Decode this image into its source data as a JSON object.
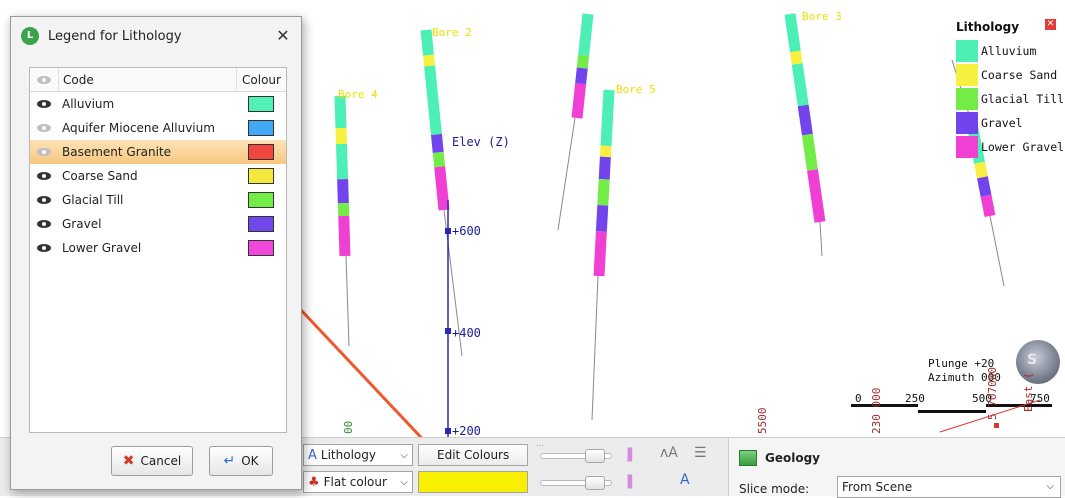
{
  "scene": {
    "bores": [
      {
        "label": "Bore 2"
      },
      {
        "label": "Bore 3"
      },
      {
        "label": "Bore 4"
      },
      {
        "label": "Bore 5"
      }
    ],
    "axis": {
      "title": "Elev (Z)",
      "ticks": [
        "+600",
        "+400",
        "+200"
      ]
    },
    "legend": {
      "title": "Lithology",
      "items": [
        {
          "label": "Alluvium",
          "color": "#4cf0b4"
        },
        {
          "label": "Coarse Sand",
          "color": "#f8f040"
        },
        {
          "label": "Glacial Till",
          "color": "#74ec48"
        },
        {
          "label": "Gravel",
          "color": "#7244ec"
        },
        {
          "label": "Lower Gravel",
          "color": "#f040d4"
        }
      ]
    },
    "orientation": {
      "plunge": "Plunge +20",
      "azimuth": "Azimuth 000"
    },
    "scale_bar": {
      "labels": [
        "0",
        "250",
        "500",
        "750"
      ]
    },
    "coordinates": [
      "00",
      "5500",
      "230 000",
      "5 707000",
      "East ("
    ]
  },
  "dialog": {
    "title": "Legend for Lithology",
    "columns": {
      "code": "Code",
      "colour": "Colour"
    },
    "rows": [
      {
        "code": "Alluvium",
        "color": "#4ff2b4",
        "visible": true,
        "selected": false
      },
      {
        "code": "Aquifer Miocene Alluvium",
        "color": "#3fa9f5",
        "visible": false,
        "selected": false
      },
      {
        "code": "Basement Granite",
        "color": "#f2473f",
        "visible": false,
        "selected": true
      },
      {
        "code": "Coarse Sand",
        "color": "#f5ea3c",
        "visible": true,
        "selected": false
      },
      {
        "code": "Glacial Till",
        "color": "#74ec48",
        "visible": true,
        "selected": false
      },
      {
        "code": "Gravel",
        "color": "#7247ec",
        "visible": true,
        "selected": false
      },
      {
        "code": "Lower Gravel",
        "color": "#f247dc",
        "visible": true,
        "selected": false
      }
    ],
    "cancel_label": "Cancel",
    "ok_label": "OK"
  },
  "toolbar": {
    "colour_field": "Lithology",
    "edit_colours_label": "Edit Colours",
    "colour_mode": "Flat colour",
    "flat_colour": "#f8f000"
  },
  "properties": {
    "title": "Geology",
    "slice_mode_label": "Slice mode:",
    "slice_mode_value": "From Scene"
  }
}
